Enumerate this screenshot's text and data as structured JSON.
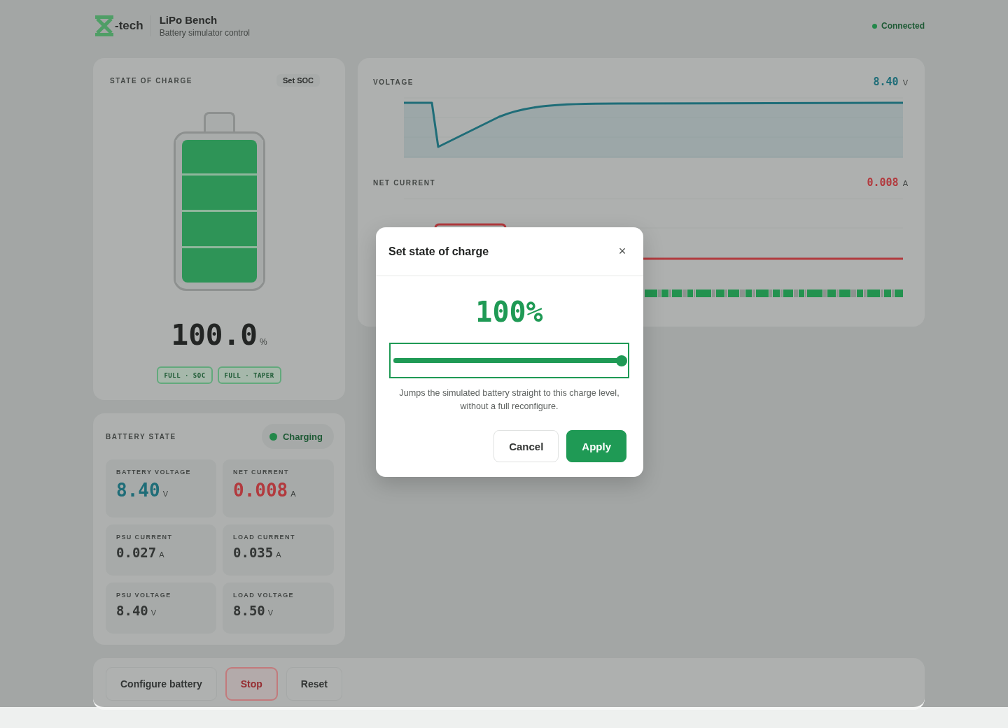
{
  "header": {
    "logo_text": "-tech",
    "title": "LiPo Bench",
    "subtitle": "Battery simulator control",
    "status": {
      "label": "Connected",
      "color": "#23884a"
    }
  },
  "soc_card": {
    "title": "STATE OF CHARGE",
    "action": "Set SOC",
    "level": 1,
    "reading": "100.0",
    "unit": "%",
    "badges": [
      "FULL · SOC",
      "FULL · TAPER"
    ]
  },
  "battery_state": {
    "title": "BATTERY STATE",
    "status": {
      "label": "Charging",
      "color": "#23884a"
    },
    "metrics": [
      {
        "label": "BATTERY VOLTAGE",
        "value": "8.40",
        "unit": "V",
        "kind": "primary",
        "color": "#1f6d78"
      },
      {
        "label": "NET CURRENT",
        "value": "0.008",
        "unit": "A",
        "kind": "primary",
        "color": "#b23a3e"
      },
      {
        "label": "PSU CURRENT",
        "value": "0.027",
        "unit": "A",
        "kind": "secondary",
        "color": "#333635"
      },
      {
        "label": "LOAD CURRENT",
        "value": "0.035",
        "unit": "A",
        "kind": "secondary",
        "color": "#333635"
      },
      {
        "label": "PSU VOLTAGE",
        "value": "8.40",
        "unit": "V",
        "kind": "secondary",
        "color": "#333635"
      },
      {
        "label": "LOAD VOLTAGE",
        "value": "8.50",
        "unit": "V",
        "kind": "secondary",
        "color": "#333635"
      }
    ]
  },
  "charts": [
    {
      "title": "VOLTAGE",
      "reading": "8.40",
      "unit": "V",
      "kind": "area",
      "color": "#1f6d78"
    },
    {
      "title": "NET CURRENT",
      "reading": "0.008",
      "unit": "A",
      "kind": "step",
      "color": "#b23a3e"
    }
  ],
  "controls": [
    {
      "label": "Configure battery",
      "kind": "plain"
    },
    {
      "label": "Stop",
      "kind": "danger"
    },
    {
      "label": "Reset",
      "kind": "plain"
    }
  ],
  "dialog": {
    "title": "Set state of charge",
    "close": "×",
    "reading": "100%",
    "slider": {
      "level": 1
    },
    "help": "Jumps the simulated battery straight to this charge level, without a full reconfigure.",
    "buttons": [
      {
        "label": "Cancel",
        "kind": "secondary"
      },
      {
        "label": "Apply",
        "kind": "primary"
      }
    ]
  }
}
